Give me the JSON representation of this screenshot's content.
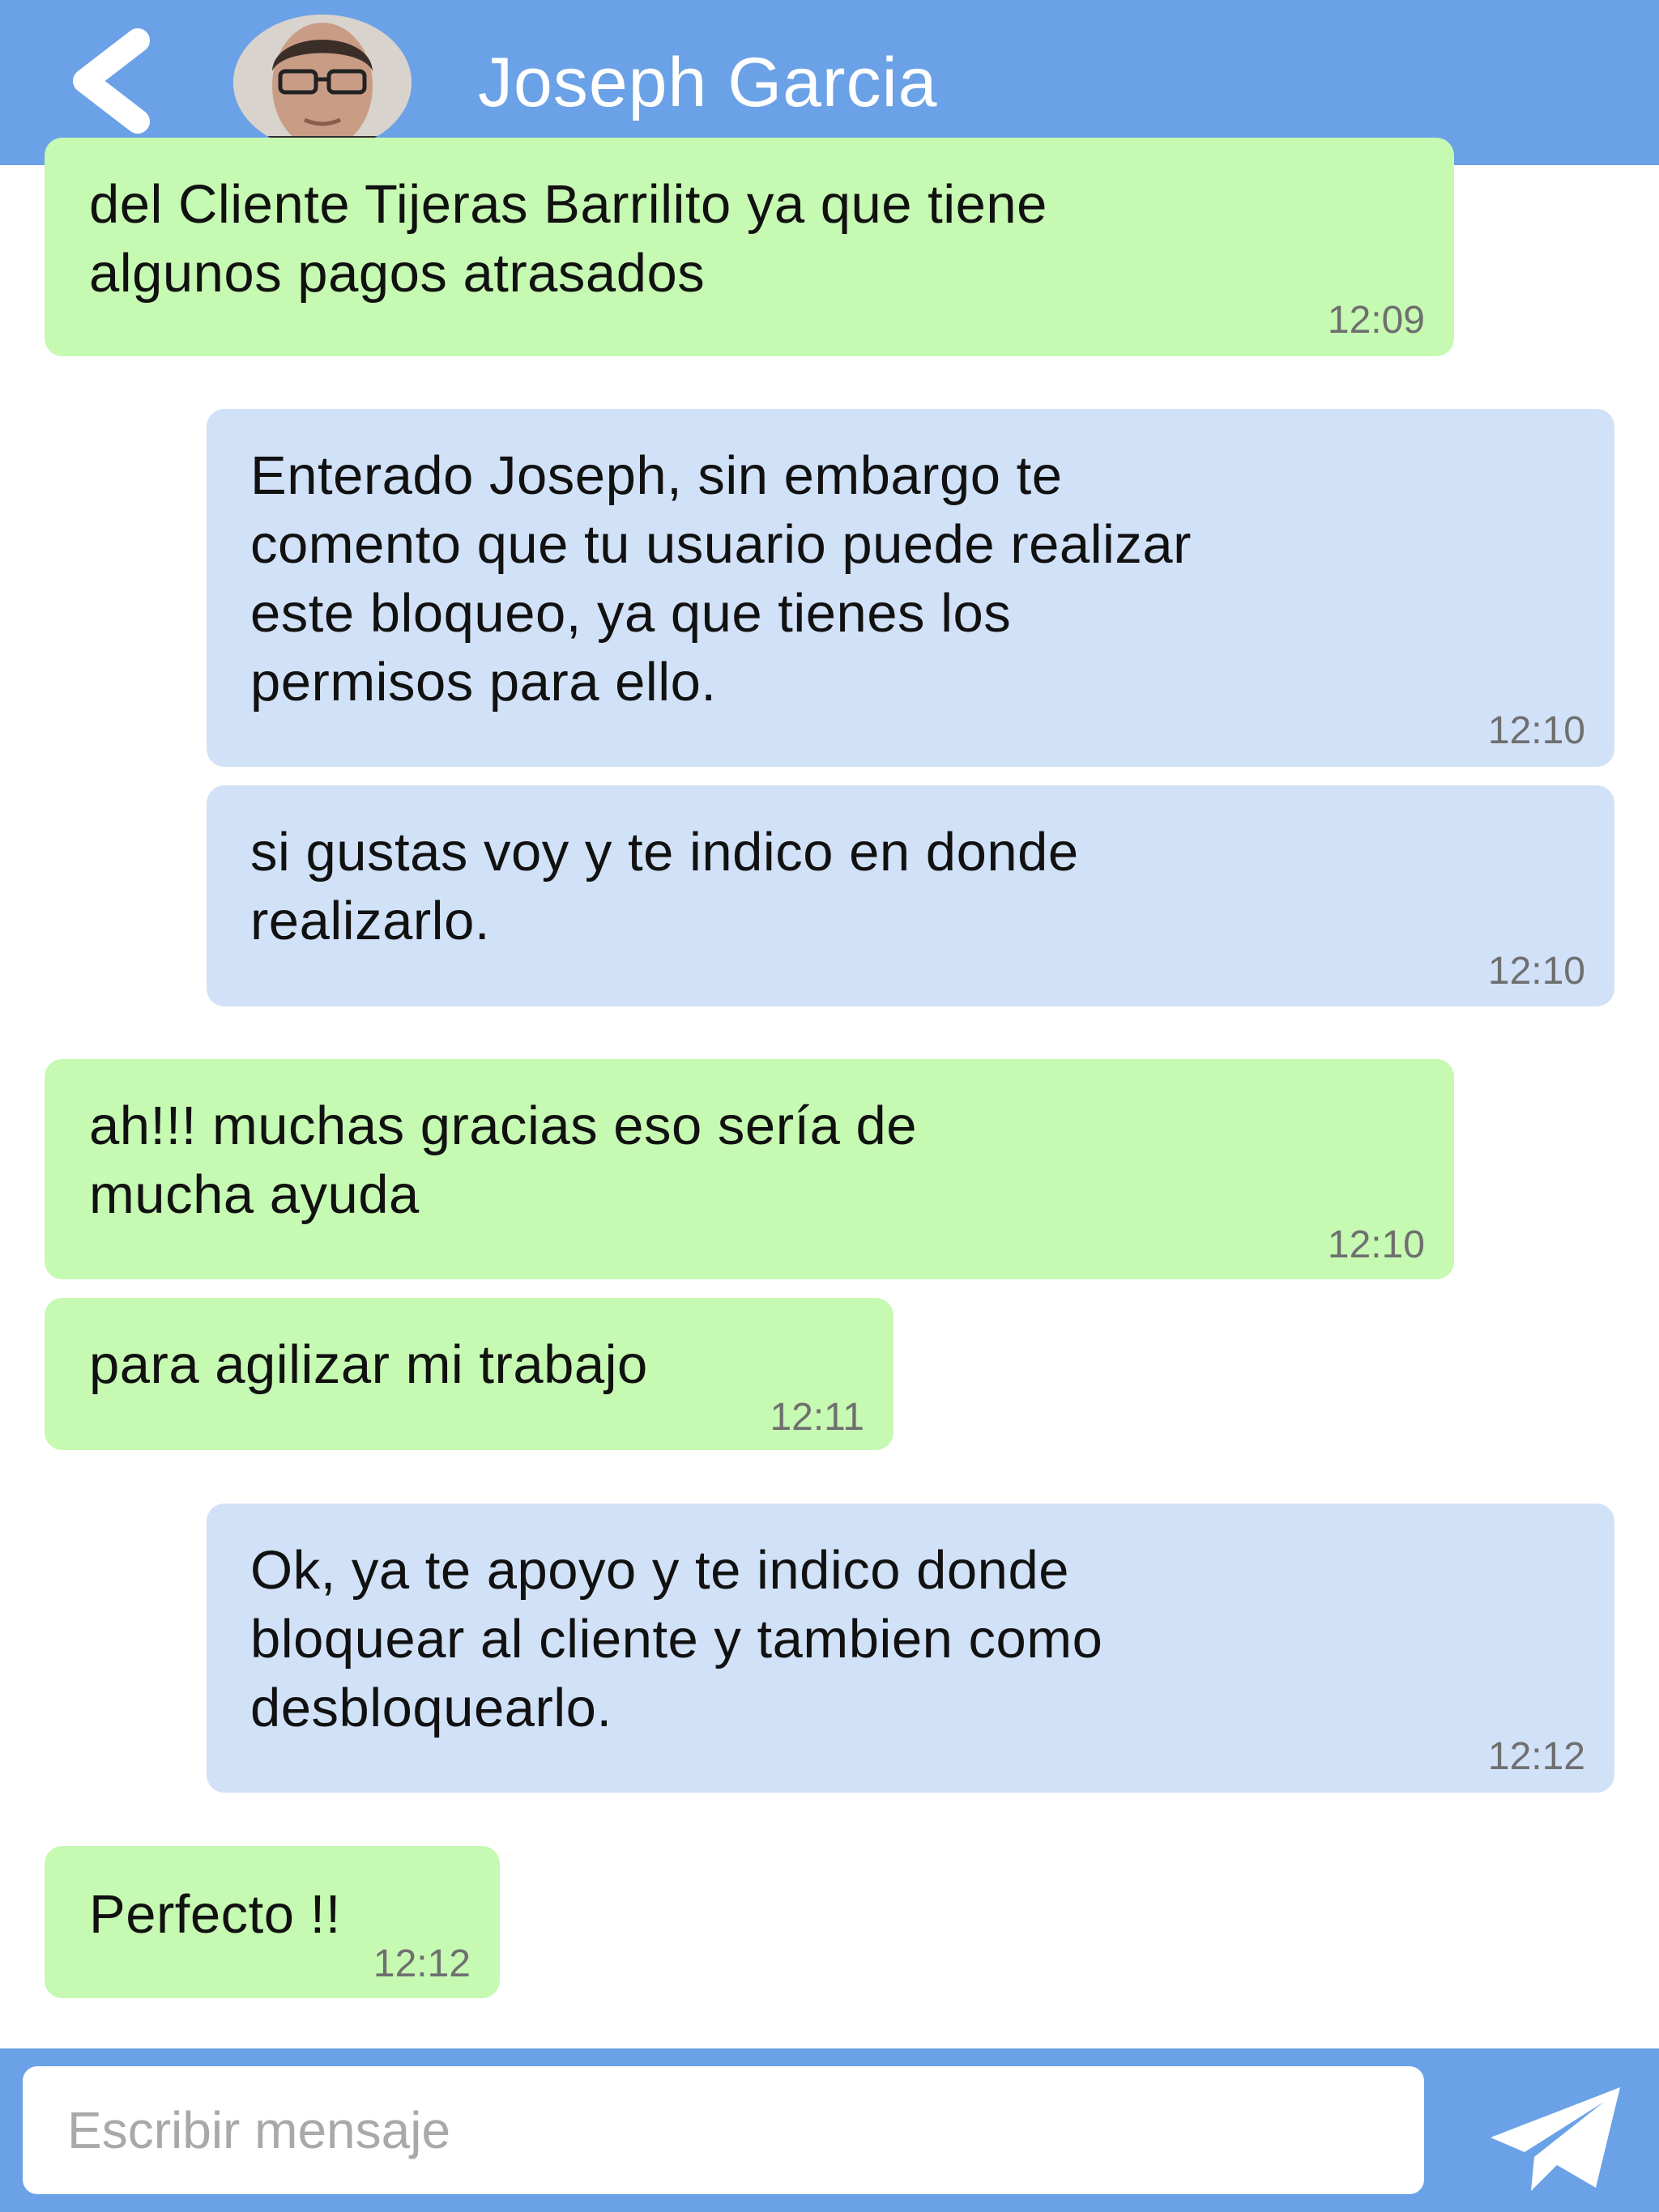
{
  "header": {
    "contact_name": "Joseph Garcia",
    "back_icon": "chevron-left-icon",
    "avatar_icon": "contact-avatar"
  },
  "messages": [
    {
      "direction": "incoming",
      "text": "del Cliente Tijeras Barrilito ya que tiene\nalgunos pagos atrasados",
      "time": "12:09"
    },
    {
      "direction": "outgoing",
      "text": "Enterado Joseph, sin embargo te\ncomento que tu usuario puede realizar\neste bloqueo, ya que tienes los\npermisos para ello.",
      "time": "12:10"
    },
    {
      "direction": "outgoing",
      "text": "si gustas voy y te indico en donde\nrealizarlo.",
      "time": "12:10"
    },
    {
      "direction": "incoming",
      "text": "ah!!! muchas gracias eso sería de\nmucha ayuda",
      "time": "12:10"
    },
    {
      "direction": "incoming",
      "text": "para agilizar mi trabajo",
      "time": "12:11"
    },
    {
      "direction": "outgoing",
      "text": "Ok, ya te apoyo y te indico donde\nbloquear al cliente y tambien como\ndesbloquearlo.",
      "time": "12:12"
    },
    {
      "direction": "incoming",
      "text": "Perfecto !!",
      "time": "12:12"
    }
  ],
  "composer": {
    "placeholder": "Escribir mensaje",
    "value": "",
    "send_icon": "paper-plane-send-icon"
  },
  "colors": {
    "header_bar": "#6ba1e6",
    "incoming_bubble": "#c6f9b2",
    "outgoing_bubble": "#d1e1f7",
    "timestamp": "#6f6f6f",
    "background": "#ffffff"
  }
}
